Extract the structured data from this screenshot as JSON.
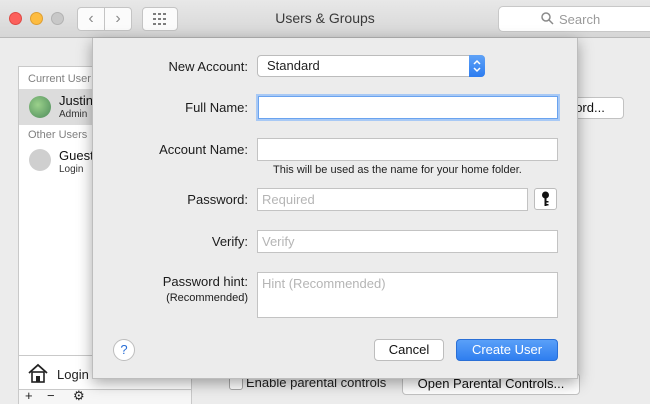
{
  "window": {
    "title": "Users & Groups"
  },
  "search": {
    "placeholder": "Search"
  },
  "sidebar": {
    "current_users_header": "Current User",
    "current_user": {
      "name": "Justin",
      "role": "Admin"
    },
    "other_users_header": "Other Users",
    "other_user": {
      "name": "Guest",
      "role": "Login"
    },
    "login_options_label": "Login"
  },
  "background": {
    "password_button": "ord...",
    "enable_parental_controls": "Enable parental controls",
    "open_parental_controls": "Open Parental Controls..."
  },
  "sheet": {
    "new_account_label": "New Account:",
    "new_account_value": "Standard",
    "full_name_label": "Full Name:",
    "full_name_value": "",
    "account_name_label": "Account Name:",
    "account_name_value": "",
    "account_name_hint": "This will be used as the name for your home folder.",
    "password_label": "Password:",
    "password_placeholder": "Required",
    "verify_label": "Verify:",
    "verify_placeholder": "Verify",
    "hint_label": "Password hint:",
    "hint_sublabel": "(Recommended)",
    "hint_placeholder": "Hint (Recommended)",
    "help_label": "?",
    "cancel_label": "Cancel",
    "create_label": "Create User"
  },
  "icons": {
    "back": "chevron-left-icon",
    "forward": "chevron-right-icon",
    "grid": "grid-icon",
    "search": "search-icon",
    "key": "key-icon",
    "house": "house-icon",
    "gear": "gear-icon"
  },
  "colors": {
    "accent": "#2f7eef",
    "focus_ring": "#a8c9f5"
  }
}
